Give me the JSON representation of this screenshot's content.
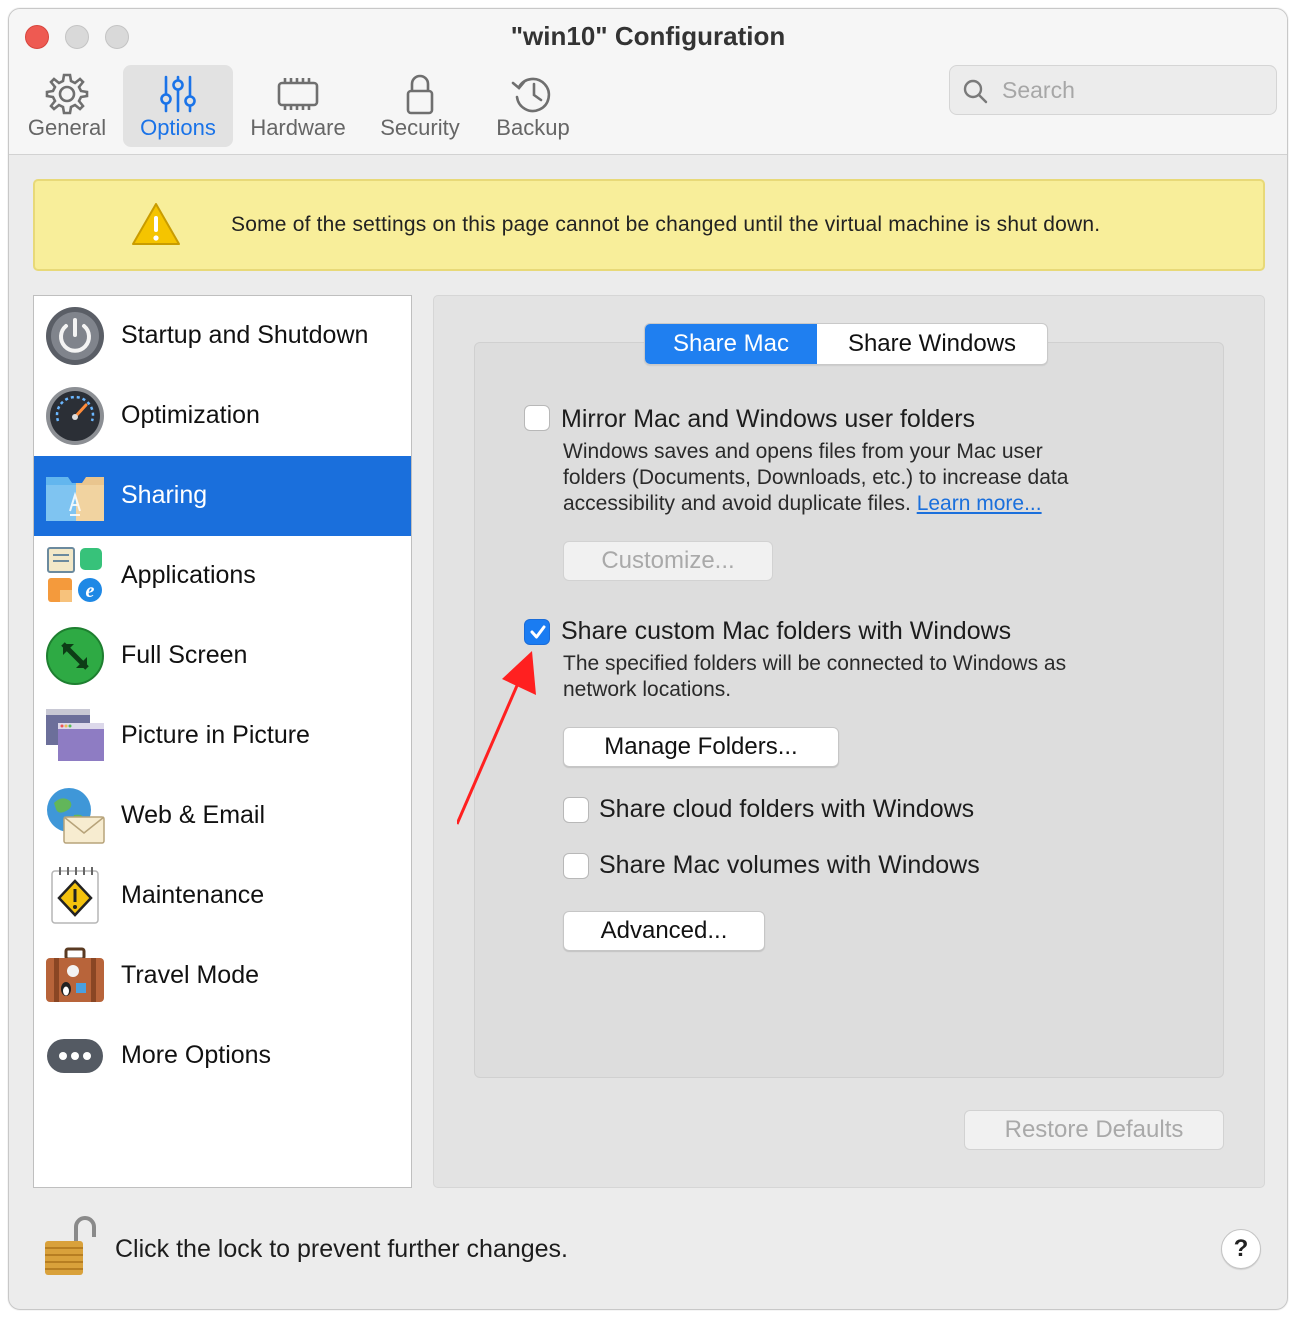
{
  "window": {
    "title": "\"win10\" Configuration"
  },
  "toolbar": {
    "items": [
      {
        "label": "General",
        "icon": "gear-icon"
      },
      {
        "label": "Options",
        "icon": "sliders-icon",
        "selected": true
      },
      {
        "label": "Hardware",
        "icon": "chip-icon"
      },
      {
        "label": "Security",
        "icon": "lock-icon"
      },
      {
        "label": "Backup",
        "icon": "clock-history-icon"
      }
    ]
  },
  "search": {
    "placeholder": "Search"
  },
  "banner": {
    "text": "Some of the settings on this page cannot be changed until the virtual machine is shut down."
  },
  "sidebar": {
    "items": [
      {
        "label": "Startup and Shutdown",
        "icon": "power-icon"
      },
      {
        "label": "Optimization",
        "icon": "speedometer-icon"
      },
      {
        "label": "Sharing",
        "icon": "shared-folder-icon",
        "selected": true
      },
      {
        "label": "Applications",
        "icon": "applications-icon"
      },
      {
        "label": "Full Screen",
        "icon": "full-screen-icon"
      },
      {
        "label": "Picture in Picture",
        "icon": "picture-in-picture-icon"
      },
      {
        "label": "Web & Email",
        "icon": "globe-mail-icon"
      },
      {
        "label": "Maintenance",
        "icon": "maintenance-icon"
      },
      {
        "label": "Travel Mode",
        "icon": "suitcase-icon"
      },
      {
        "label": "More Options",
        "icon": "more-icon"
      }
    ]
  },
  "sharing": {
    "tabs": {
      "share_mac": "Share Mac",
      "share_windows": "Share Windows"
    },
    "mirror": {
      "label": "Mirror Mac and Windows user folders",
      "checked": false,
      "desc_line1": "Windows saves and opens files from your Mac user",
      "desc_line2": "folders (Documents, Downloads, etc.) to increase data",
      "desc_line3": "accessibility and avoid duplicate files.",
      "learn_more": "Learn more...",
      "customize_button": "Customize..."
    },
    "custom": {
      "label": "Share custom Mac folders with Windows",
      "checked": true,
      "desc_line1": "The specified folders will be connected to Windows as",
      "desc_line2": "network locations.",
      "manage_button": "Manage Folders..."
    },
    "cloud": {
      "label": "Share cloud folders with Windows",
      "checked": false
    },
    "volumes": {
      "label": "Share Mac volumes with Windows",
      "checked": false
    },
    "advanced_button": "Advanced...",
    "restore_button": "Restore Defaults"
  },
  "footer": {
    "lock_text": "Click the lock to prevent further changes.",
    "help": "?"
  },
  "colors": {
    "accent": "#1a6fdc",
    "banner": "#f8ee9a",
    "annotation_arrow": "#ff2020"
  }
}
